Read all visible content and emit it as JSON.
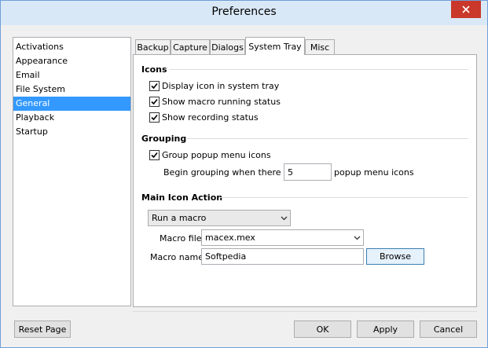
{
  "window": {
    "title": "Preferences"
  },
  "sidebar": {
    "items": [
      {
        "label": "Activations"
      },
      {
        "label": "Appearance"
      },
      {
        "label": "Email"
      },
      {
        "label": "File System"
      },
      {
        "label": "General",
        "selected": true
      },
      {
        "label": "Playback"
      },
      {
        "label": "Startup"
      }
    ]
  },
  "tabs": [
    {
      "label": "Backup"
    },
    {
      "label": "Capture"
    },
    {
      "label": "Dialogs"
    },
    {
      "label": "System Tray",
      "active": true
    },
    {
      "label": "Misc"
    }
  ],
  "icons_group": {
    "heading": "Icons",
    "checks": [
      {
        "label": "Display icon in system tray",
        "checked": true
      },
      {
        "label": "Show macro running status",
        "checked": true
      },
      {
        "label": "Show recording status",
        "checked": true
      }
    ]
  },
  "grouping_group": {
    "heading": "Grouping",
    "check": {
      "label": "Group popup menu icons",
      "checked": true
    },
    "begin_label": "Begin grouping when there are",
    "count_value": "5",
    "suffix_label": "popup menu icons"
  },
  "main_action": {
    "heading": "Main Icon Action",
    "action_value": "Run a macro",
    "macro_file_label": "Macro file:",
    "macro_file_value": "macex.mex",
    "macro_name_label": "Macro name:",
    "macro_name_value": "Softpedia",
    "browse_label": "Browse"
  },
  "footer": {
    "reset_label": "Reset Page",
    "ok_label": "OK",
    "apply_label": "Apply",
    "cancel_label": "Cancel"
  },
  "colors": {
    "selection": "#3399ff",
    "titlebar": "#d9e8f7",
    "close": "#c9382a"
  }
}
